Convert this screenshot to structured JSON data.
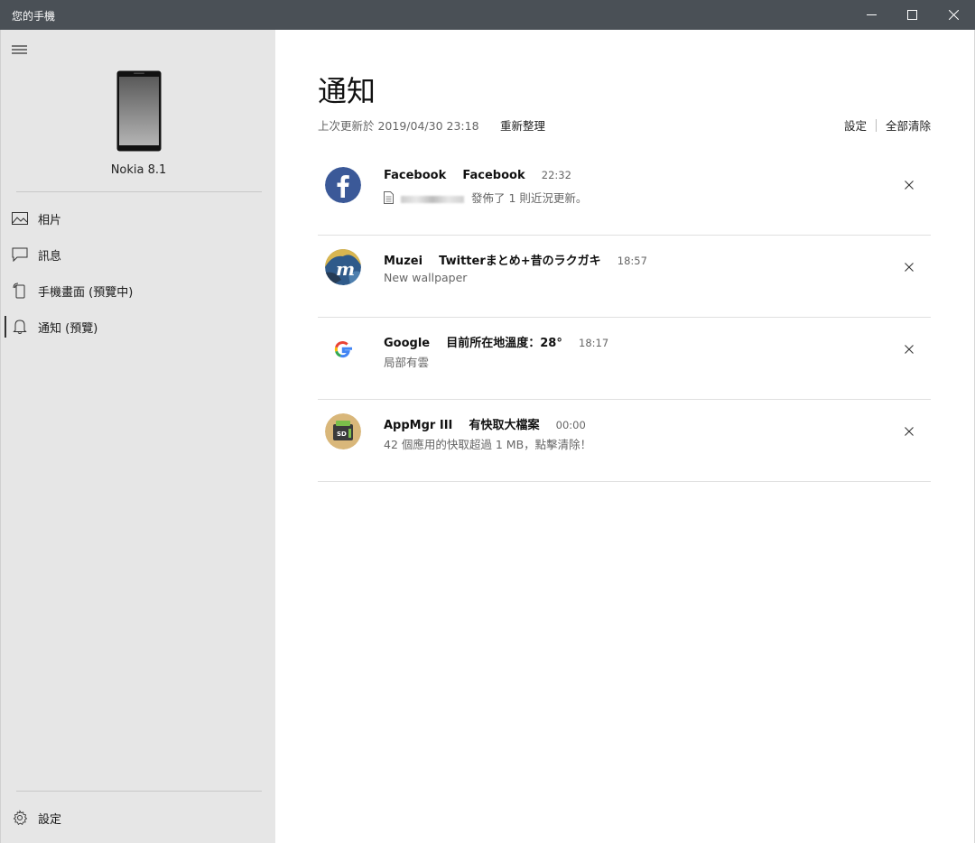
{
  "window": {
    "title": "您的手機"
  },
  "sidebar": {
    "device_name": "Nokia 8.1",
    "items": [
      {
        "label": "相片",
        "icon": "photo-icon"
      },
      {
        "label": "訊息",
        "icon": "message-icon"
      },
      {
        "label": "手機畫面 (預覽中)",
        "icon": "phone-screen-icon"
      },
      {
        "label": "通知 (預覽)",
        "icon": "bell-icon",
        "active": true
      }
    ],
    "settings_label": "設定"
  },
  "main": {
    "title": "通知",
    "last_updated": "上次更新於 2019/04/30 23:18",
    "refresh_label": "重新整理",
    "settings_label": "設定",
    "clear_all_label": "全部清除",
    "notifications": [
      {
        "app": "Facebook",
        "title": "Facebook",
        "time": "22:32",
        "body": "發佈了 1 則近況更新。",
        "icon": "facebook-icon"
      },
      {
        "app": "Muzei",
        "title": "Twitterまとめ+昔のラクガキ",
        "time": "18:57",
        "body": "New wallpaper",
        "icon": "muzei-icon"
      },
      {
        "app": "Google",
        "title": "目前所在地溫度：28°",
        "time": "18:17",
        "body": "局部有雲",
        "icon": "google-icon"
      },
      {
        "app": "AppMgr III",
        "title": "有快取大檔案",
        "time": "00:00",
        "body": "42 個應用的快取超過 1 MB，點擊清除！",
        "icon": "appmgr-icon"
      }
    ]
  },
  "colors": {
    "titlebar": "#4a5056",
    "sidebar": "#e6e6e6",
    "facebook": "#3b5998"
  }
}
